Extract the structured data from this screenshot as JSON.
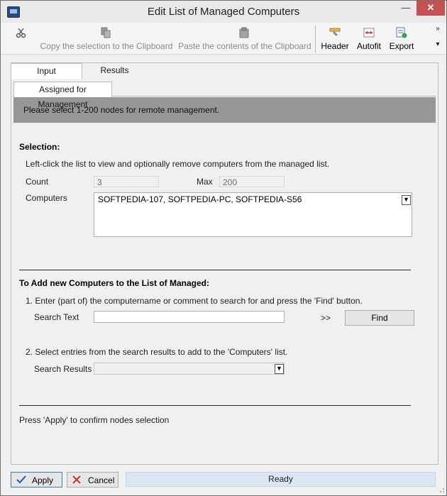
{
  "window": {
    "title": "Edit List of Managed Computers",
    "minimize_glyph": "—",
    "close_glyph": "✕"
  },
  "toolbar": {
    "cut_icon": "scissors-icon",
    "copy_label": "Copy the selection to the Clipboard",
    "paste_label": "Paste the contents of the Clipboard",
    "header_label": "Header",
    "autofit_label": "Autofit",
    "export_label": "Export",
    "overflow_glyph": "»",
    "overflow_arrow": "▾"
  },
  "tabs": {
    "input": "Input",
    "results": "Results"
  },
  "subtabs": {
    "assigned": "Assigned for Management"
  },
  "banner": "Please select 1-200 nodes for remote management.",
  "selection": {
    "title": "Selection:",
    "help": "Left-click the list to view and optionally remove computers from the managed list.",
    "count_label": "Count",
    "count_value": "3",
    "max_label": "Max",
    "max_value": "200",
    "computers_label": "Computers",
    "computers_value": "SOFTPEDIA-107, SOFTPEDIA-PC, SOFTPEDIA-S56"
  },
  "add": {
    "title": "To Add new Computers to the List of Managed:",
    "step1": "1. Enter (part of) the computername or comment to search for and press the 'Find' button.",
    "search_text_label": "Search Text",
    "search_text_value": "",
    "arrows": ">>",
    "find_label": "Find",
    "step2": "2. Select entries from the search results to add to the 'Computers' list.",
    "search_results_label": "Search Results",
    "search_results_value": ""
  },
  "footer_note": "Press 'Apply' to confirm nodes selection",
  "buttons": {
    "apply": "Apply",
    "cancel": "Cancel"
  },
  "status": "Ready",
  "colors": {
    "banner": "#979797",
    "status_bg": "#dbe6f4",
    "close_bg": "#c75050"
  }
}
